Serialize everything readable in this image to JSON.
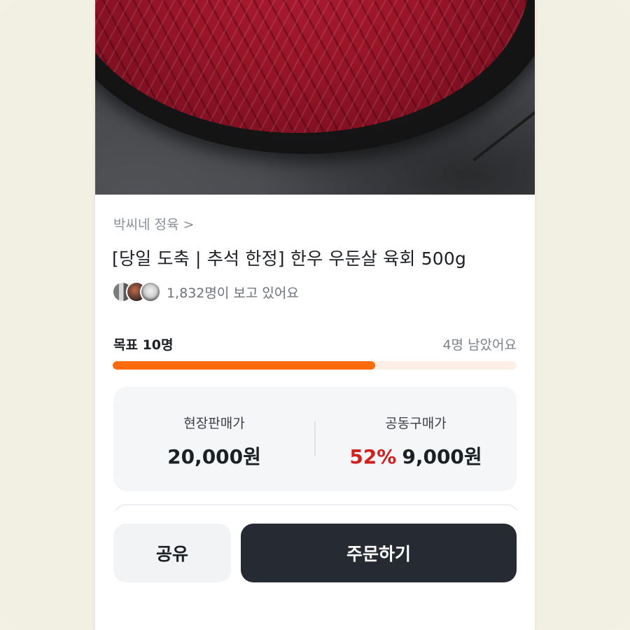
{
  "product": {
    "shop_name": "박씨네 정육",
    "shop_chevron": ">",
    "title": "[당일 도축 | 추석 한정] 한우 우둔살 육회 500g",
    "viewers_text": "1,832명이 보고 있어요"
  },
  "goal": {
    "label": "목표 10명",
    "remaining_text": "4명 남았어요",
    "progress_fraction": 0.65
  },
  "price": {
    "onsite_label": "현장판매가",
    "onsite_value": "20,000원",
    "group_label": "공동구매가",
    "discount": "52%",
    "group_value": "9,000원"
  },
  "actions": {
    "share_label": "공유",
    "order_label": "주문하기"
  },
  "colors": {
    "accent": "#fb6b0a",
    "discount": "#d11f1f",
    "primary_button": "#252a33"
  }
}
